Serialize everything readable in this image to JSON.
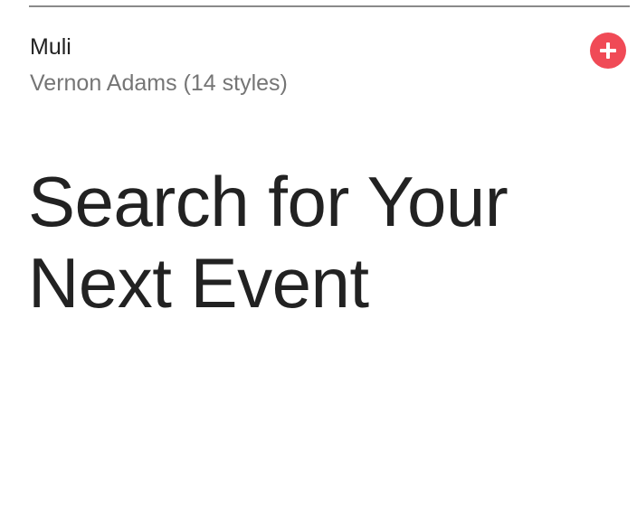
{
  "font_card": {
    "name": "Muli",
    "designer_info": "Vernon Adams (14 styles)",
    "sample_lines": [
      "Search for Your",
      "Next Event"
    ],
    "add_button_icon": "plus-icon",
    "accent_color": "#f04a56"
  }
}
